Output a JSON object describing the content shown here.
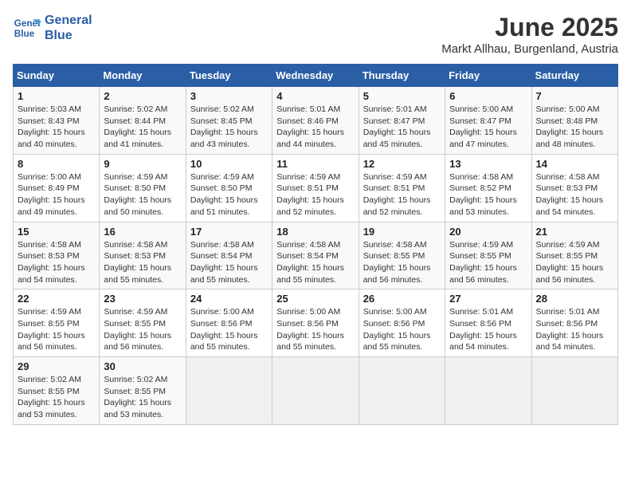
{
  "logo": {
    "line1": "General",
    "line2": "Blue"
  },
  "title": "June 2025",
  "location": "Markt Allhau, Burgenland, Austria",
  "weekdays": [
    "Sunday",
    "Monday",
    "Tuesday",
    "Wednesday",
    "Thursday",
    "Friday",
    "Saturday"
  ],
  "weeks": [
    [
      {
        "day": "1",
        "info": "Sunrise: 5:03 AM\nSunset: 8:43 PM\nDaylight: 15 hours\nand 40 minutes."
      },
      {
        "day": "2",
        "info": "Sunrise: 5:02 AM\nSunset: 8:44 PM\nDaylight: 15 hours\nand 41 minutes."
      },
      {
        "day": "3",
        "info": "Sunrise: 5:02 AM\nSunset: 8:45 PM\nDaylight: 15 hours\nand 43 minutes."
      },
      {
        "day": "4",
        "info": "Sunrise: 5:01 AM\nSunset: 8:46 PM\nDaylight: 15 hours\nand 44 minutes."
      },
      {
        "day": "5",
        "info": "Sunrise: 5:01 AM\nSunset: 8:47 PM\nDaylight: 15 hours\nand 45 minutes."
      },
      {
        "day": "6",
        "info": "Sunrise: 5:00 AM\nSunset: 8:47 PM\nDaylight: 15 hours\nand 47 minutes."
      },
      {
        "day": "7",
        "info": "Sunrise: 5:00 AM\nSunset: 8:48 PM\nDaylight: 15 hours\nand 48 minutes."
      }
    ],
    [
      {
        "day": "8",
        "info": "Sunrise: 5:00 AM\nSunset: 8:49 PM\nDaylight: 15 hours\nand 49 minutes."
      },
      {
        "day": "9",
        "info": "Sunrise: 4:59 AM\nSunset: 8:50 PM\nDaylight: 15 hours\nand 50 minutes."
      },
      {
        "day": "10",
        "info": "Sunrise: 4:59 AM\nSunset: 8:50 PM\nDaylight: 15 hours\nand 51 minutes."
      },
      {
        "day": "11",
        "info": "Sunrise: 4:59 AM\nSunset: 8:51 PM\nDaylight: 15 hours\nand 52 minutes."
      },
      {
        "day": "12",
        "info": "Sunrise: 4:59 AM\nSunset: 8:51 PM\nDaylight: 15 hours\nand 52 minutes."
      },
      {
        "day": "13",
        "info": "Sunrise: 4:58 AM\nSunset: 8:52 PM\nDaylight: 15 hours\nand 53 minutes."
      },
      {
        "day": "14",
        "info": "Sunrise: 4:58 AM\nSunset: 8:53 PM\nDaylight: 15 hours\nand 54 minutes."
      }
    ],
    [
      {
        "day": "15",
        "info": "Sunrise: 4:58 AM\nSunset: 8:53 PM\nDaylight: 15 hours\nand 54 minutes."
      },
      {
        "day": "16",
        "info": "Sunrise: 4:58 AM\nSunset: 8:53 PM\nDaylight: 15 hours\nand 55 minutes."
      },
      {
        "day": "17",
        "info": "Sunrise: 4:58 AM\nSunset: 8:54 PM\nDaylight: 15 hours\nand 55 minutes."
      },
      {
        "day": "18",
        "info": "Sunrise: 4:58 AM\nSunset: 8:54 PM\nDaylight: 15 hours\nand 55 minutes."
      },
      {
        "day": "19",
        "info": "Sunrise: 4:58 AM\nSunset: 8:55 PM\nDaylight: 15 hours\nand 56 minutes."
      },
      {
        "day": "20",
        "info": "Sunrise: 4:59 AM\nSunset: 8:55 PM\nDaylight: 15 hours\nand 56 minutes."
      },
      {
        "day": "21",
        "info": "Sunrise: 4:59 AM\nSunset: 8:55 PM\nDaylight: 15 hours\nand 56 minutes."
      }
    ],
    [
      {
        "day": "22",
        "info": "Sunrise: 4:59 AM\nSunset: 8:55 PM\nDaylight: 15 hours\nand 56 minutes."
      },
      {
        "day": "23",
        "info": "Sunrise: 4:59 AM\nSunset: 8:55 PM\nDaylight: 15 hours\nand 56 minutes."
      },
      {
        "day": "24",
        "info": "Sunrise: 5:00 AM\nSunset: 8:56 PM\nDaylight: 15 hours\nand 55 minutes."
      },
      {
        "day": "25",
        "info": "Sunrise: 5:00 AM\nSunset: 8:56 PM\nDaylight: 15 hours\nand 55 minutes."
      },
      {
        "day": "26",
        "info": "Sunrise: 5:00 AM\nSunset: 8:56 PM\nDaylight: 15 hours\nand 55 minutes."
      },
      {
        "day": "27",
        "info": "Sunrise: 5:01 AM\nSunset: 8:56 PM\nDaylight: 15 hours\nand 54 minutes."
      },
      {
        "day": "28",
        "info": "Sunrise: 5:01 AM\nSunset: 8:56 PM\nDaylight: 15 hours\nand 54 minutes."
      }
    ],
    [
      {
        "day": "29",
        "info": "Sunrise: 5:02 AM\nSunset: 8:55 PM\nDaylight: 15 hours\nand 53 minutes."
      },
      {
        "day": "30",
        "info": "Sunrise: 5:02 AM\nSunset: 8:55 PM\nDaylight: 15 hours\nand 53 minutes."
      },
      null,
      null,
      null,
      null,
      null
    ]
  ]
}
